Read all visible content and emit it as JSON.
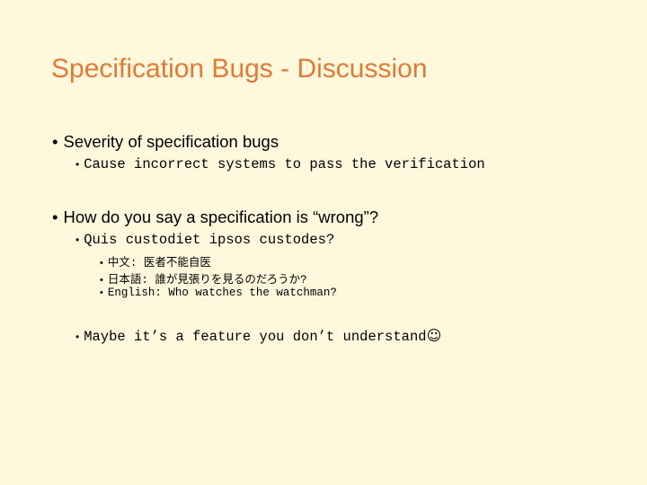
{
  "slide": {
    "title": "Specification Bugs - Discussion",
    "bullet_glyph": "•",
    "sections": [
      {
        "heading": "Severity of specification bugs",
        "items": [
          {
            "text": "Cause incorrect systems to pass the verification"
          }
        ]
      },
      {
        "heading": "How do you say a specification is “wrong”?",
        "items": [
          {
            "text": "Quis custodiet ipsos custodes?",
            "subitems": [
              "中文: 医者不能自医",
              "日本語: 誰が見張りを見るのだろうか?",
              "English: Who watches the watchman?"
            ]
          },
          {
            "text": "Maybe it’s a feature you don’t understand",
            "trailing_icon": "☺"
          }
        ]
      }
    ]
  }
}
